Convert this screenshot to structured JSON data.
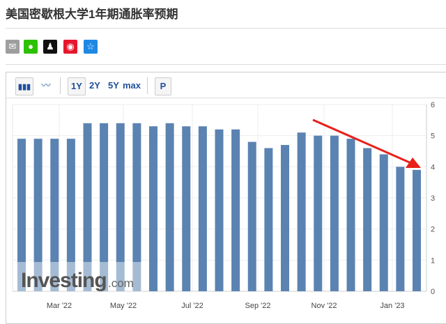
{
  "title": "美国密歇根大学1年期通胀率预期",
  "share_icons": [
    {
      "name": "mail-icon",
      "color": "#9e9e9e",
      "glyph": "✉"
    },
    {
      "name": "wechat-icon",
      "color": "#2dc100",
      "glyph": "●"
    },
    {
      "name": "qq-icon",
      "color": "#111111",
      "glyph": "♟"
    },
    {
      "name": "weibo-icon",
      "color": "#e6162d",
      "glyph": "◉"
    },
    {
      "name": "star-icon",
      "color": "#1e88e5",
      "glyph": "☆"
    }
  ],
  "toolbar": {
    "bar_icon": "bar-chart-icon",
    "line_icon": "line-chart-icon",
    "ranges": [
      "1Y",
      "2Y",
      "5Y",
      "max"
    ],
    "p": "P"
  },
  "watermark": "Investing",
  "watermark_suffix": ".com",
  "chart_data": {
    "type": "bar",
    "title": "美国密歇根大学1年期通胀率预期",
    "values": [
      4.9,
      4.9,
      4.9,
      4.9,
      5.4,
      5.4,
      5.4,
      5.4,
      5.3,
      5.4,
      5.3,
      5.3,
      5.2,
      5.2,
      4.8,
      4.6,
      4.7,
      5.1,
      5.0,
      5.0,
      4.9,
      4.6,
      4.4,
      4.0,
      3.9
    ],
    "x_ticks": [
      "Mar '22",
      "May '22",
      "Jul '22",
      "Sep '22",
      "Nov '22",
      "Jan '23"
    ],
    "y_ticks": [
      0,
      1,
      2,
      3,
      4,
      5,
      6
    ],
    "ylim": [
      0,
      6
    ],
    "bar_color": "#5b83b1",
    "annotation": "red arrow indicating downward trend"
  }
}
